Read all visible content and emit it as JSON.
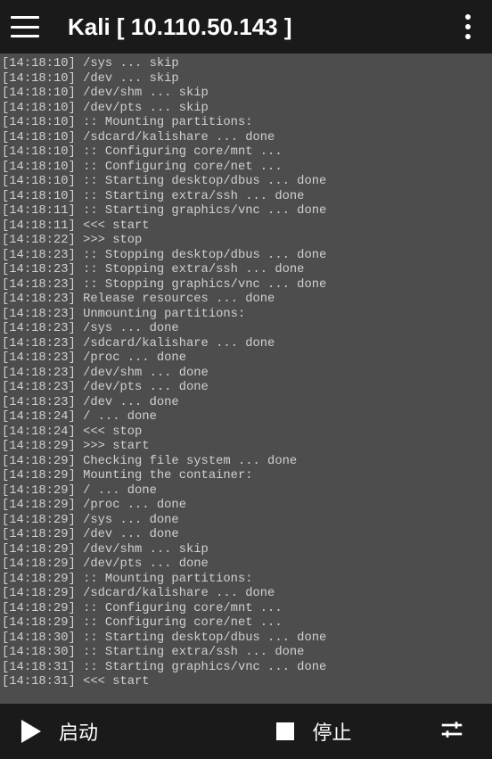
{
  "header": {
    "title": "Kali  [ 10.110.50.143 ]"
  },
  "logs": [
    {
      "ts": "[14:18:10]",
      "msg": "/sys ... skip"
    },
    {
      "ts": "[14:18:10]",
      "msg": "/dev ... skip"
    },
    {
      "ts": "[14:18:10]",
      "msg": "/dev/shm ... skip"
    },
    {
      "ts": "[14:18:10]",
      "msg": "/dev/pts ... skip"
    },
    {
      "ts": "[14:18:10]",
      "msg": ":: Mounting partitions:"
    },
    {
      "ts": "[14:18:10]",
      "msg": "/sdcard/kalishare ... done"
    },
    {
      "ts": "[14:18:10]",
      "msg": ":: Configuring core/mnt ..."
    },
    {
      "ts": "[14:18:10]",
      "msg": ":: Configuring core/net ..."
    },
    {
      "ts": "[14:18:10]",
      "msg": ":: Starting desktop/dbus ... done"
    },
    {
      "ts": "[14:18:10]",
      "msg": ":: Starting extra/ssh ... done"
    },
    {
      "ts": "[14:18:11]",
      "msg": ":: Starting graphics/vnc ... done"
    },
    {
      "ts": "[14:18:11]",
      "msg": "<<< start"
    },
    {
      "ts": "[14:18:22]",
      "msg": ">>> stop"
    },
    {
      "ts": "[14:18:23]",
      "msg": ":: Stopping desktop/dbus ... done"
    },
    {
      "ts": "[14:18:23]",
      "msg": ":: Stopping extra/ssh ... done"
    },
    {
      "ts": "[14:18:23]",
      "msg": ":: Stopping graphics/vnc ... done"
    },
    {
      "ts": "[14:18:23]",
      "msg": "Release resources ... done"
    },
    {
      "ts": "[14:18:23]",
      "msg": "Unmounting partitions:"
    },
    {
      "ts": "[14:18:23]",
      "msg": "/sys ... done"
    },
    {
      "ts": "[14:18:23]",
      "msg": "/sdcard/kalishare ... done"
    },
    {
      "ts": "[14:18:23]",
      "msg": "/proc ... done"
    },
    {
      "ts": "[14:18:23]",
      "msg": "/dev/shm ... done"
    },
    {
      "ts": "[14:18:23]",
      "msg": "/dev/pts ... done"
    },
    {
      "ts": "[14:18:23]",
      "msg": "/dev ... done"
    },
    {
      "ts": "[14:18:24]",
      "msg": "/ ... done"
    },
    {
      "ts": "[14:18:24]",
      "msg": "<<< stop"
    },
    {
      "ts": "[14:18:29]",
      "msg": ">>> start"
    },
    {
      "ts": "[14:18:29]",
      "msg": "Checking file system ... done"
    },
    {
      "ts": "[14:18:29]",
      "msg": "Mounting the container:"
    },
    {
      "ts": "[14:18:29]",
      "msg": "/ ... done"
    },
    {
      "ts": "[14:18:29]",
      "msg": "/proc ... done"
    },
    {
      "ts": "[14:18:29]",
      "msg": "/sys ... done"
    },
    {
      "ts": "[14:18:29]",
      "msg": "/dev ... done"
    },
    {
      "ts": "[14:18:29]",
      "msg": "/dev/shm ... skip"
    },
    {
      "ts": "[14:18:29]",
      "msg": "/dev/pts ... done"
    },
    {
      "ts": "[14:18:29]",
      "msg": ":: Mounting partitions:"
    },
    {
      "ts": "[14:18:29]",
      "msg": "/sdcard/kalishare ... done"
    },
    {
      "ts": "[14:18:29]",
      "msg": ":: Configuring core/mnt ..."
    },
    {
      "ts": "[14:18:29]",
      "msg": ":: Configuring core/net ..."
    },
    {
      "ts": "[14:18:30]",
      "msg": ":: Starting desktop/dbus ... done"
    },
    {
      "ts": "[14:18:30]",
      "msg": ":: Starting extra/ssh ... done"
    },
    {
      "ts": "[14:18:31]",
      "msg": ":: Starting graphics/vnc ... done"
    },
    {
      "ts": "[14:18:31]",
      "msg": "<<< start"
    }
  ],
  "bottomBar": {
    "start_label": "启动",
    "stop_label": "停止"
  }
}
